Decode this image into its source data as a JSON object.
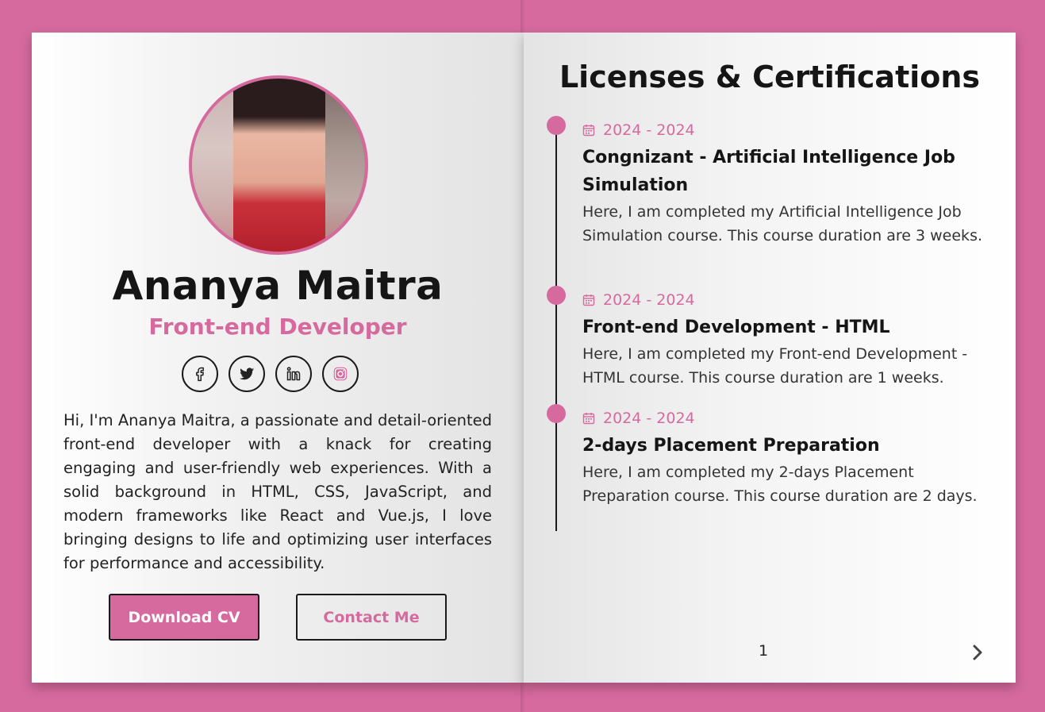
{
  "profile": {
    "name": "Ananya Maitra",
    "role": "Front-end Developer",
    "bio": "Hi, I'm Ananya Maitra, a passionate and detail-oriented front-end developer with a knack for creating engaging and user-friendly web experiences. With a solid background in HTML, CSS, JavaScript, and modern frameworks like React and Vue.js, I love bringing designs to life and optimizing user interfaces for performance and accessibility.",
    "socials": [
      "facebook-icon",
      "twitter-icon",
      "linkedin-icon",
      "instagram-icon"
    ],
    "buttons": {
      "download": "Download CV",
      "contact": "Contact Me"
    }
  },
  "certifications": {
    "title": "Licenses & Certifications",
    "items": [
      {
        "date": "2024 - 2024",
        "title": "Congnizant - Artificial Intelligence Job Simulation",
        "desc": "Here, I am completed my Artificial Intelligence Job Simulation course. This course duration are 3 weeks."
      },
      {
        "date": "2024 - 2024",
        "title": "Front-end Development - HTML",
        "desc": "Here, I am completed my Front-end Development - HTML course. This course duration are 1 weeks."
      },
      {
        "date": "2024 - 2024",
        "title": "2-days Placement Preparation",
        "desc": "Here, I am completed my 2-days Placement Preparation course. This course duration are 2 days."
      }
    ]
  },
  "pagination": {
    "page": "1"
  },
  "colors": {
    "accent": "#d66a9f",
    "text": "#151515"
  }
}
